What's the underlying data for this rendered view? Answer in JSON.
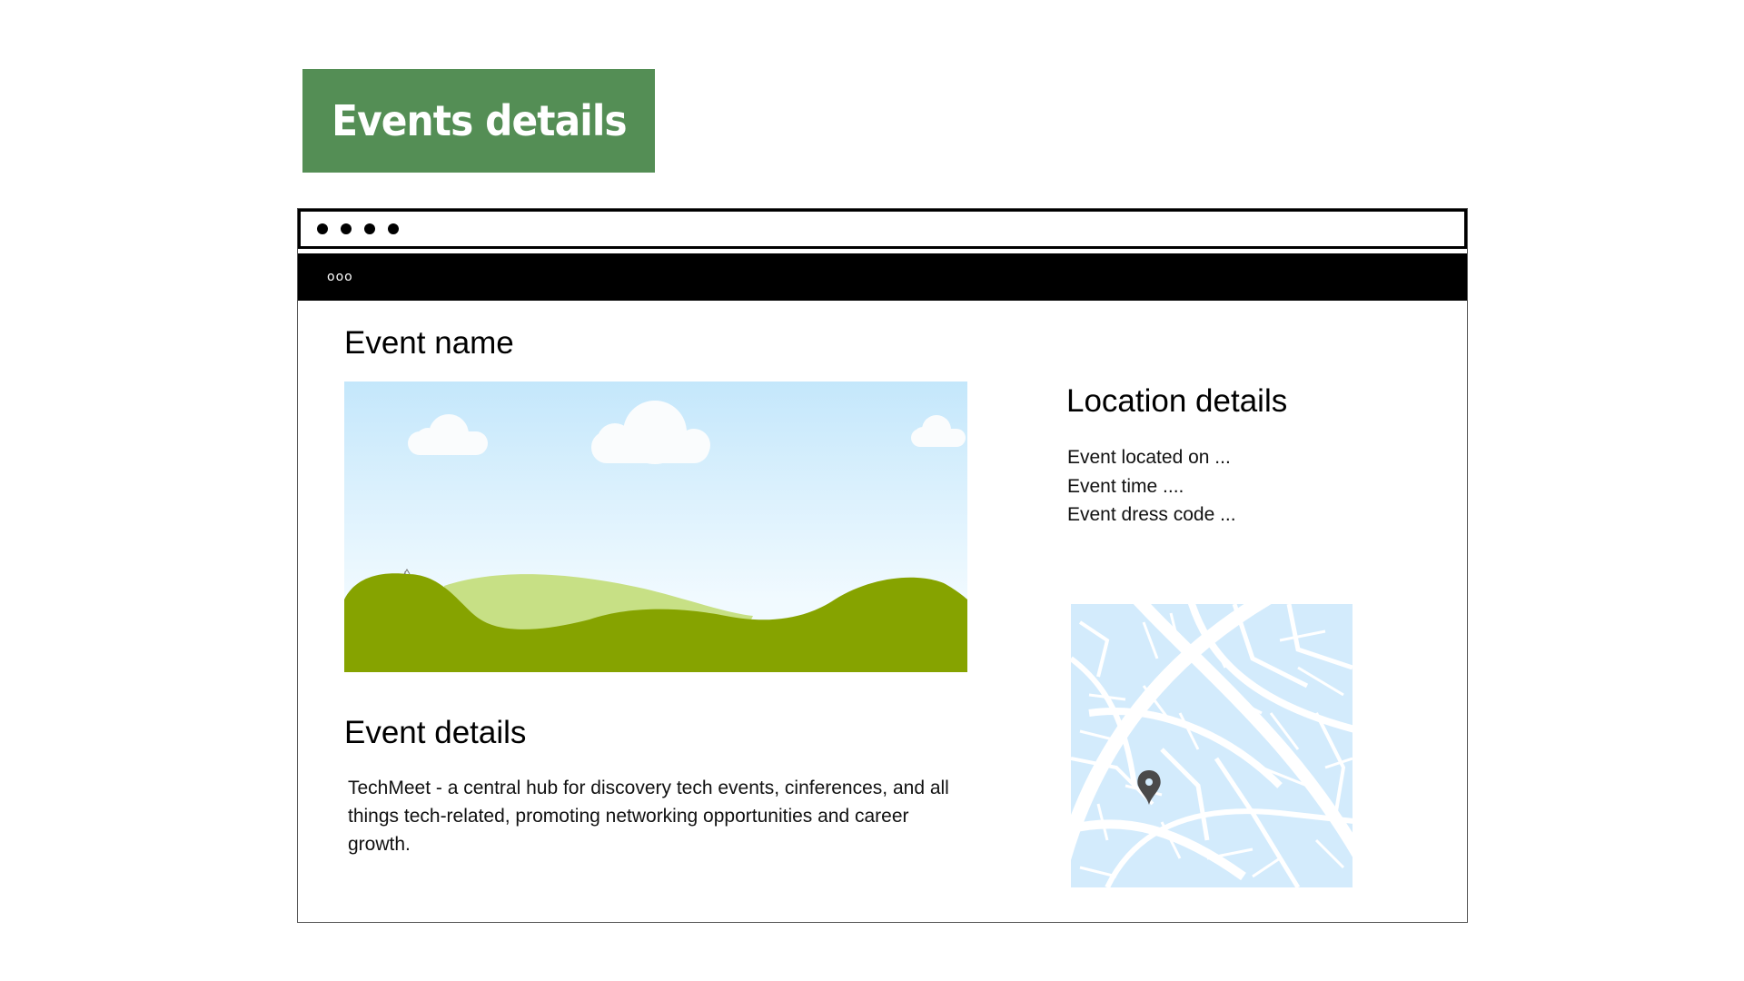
{
  "page_title": "Events details",
  "browser": {
    "window_dots": 4,
    "nav_menu_label": "ooo"
  },
  "event": {
    "name_heading": "Event name",
    "details_heading": "Event details",
    "description": "TechMeet - a central hub for discovery tech events, cinferences, and all things tech-related, promoting networking opportunities and career growth."
  },
  "location": {
    "heading": "Location details",
    "lines": [
      "Event located on ...",
      "Event time ....",
      "Event dress code ..."
    ]
  },
  "colors": {
    "title_badge": "#548e55",
    "sky_top": "#c4e7fb",
    "hill_front": "#86a300",
    "hill_back": "#c7e085",
    "map_streets": "#d3ebfc",
    "map_pin": "#4a4a4a"
  },
  "icons": {
    "map_pin": "location-pin-icon"
  }
}
